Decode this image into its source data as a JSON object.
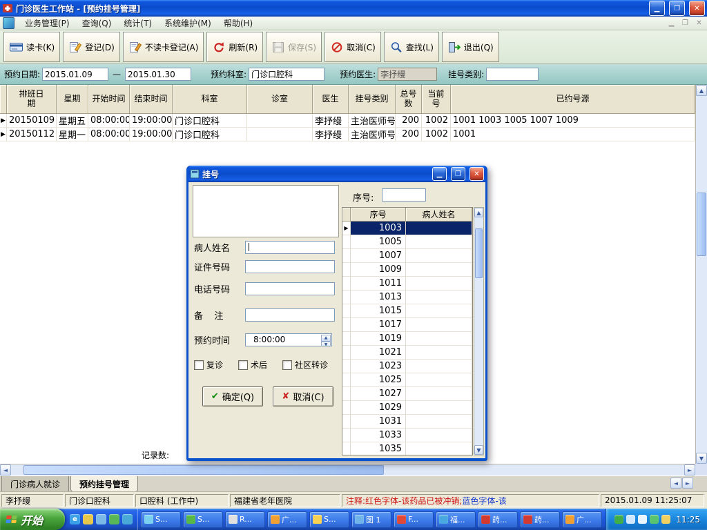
{
  "window": {
    "title": "门诊医生工作站 - [预约挂号管理]"
  },
  "menubar": {
    "items": [
      "业务管理(P)",
      "查询(Q)",
      "统计(T)",
      "系统维护(M)",
      "帮助(H)"
    ]
  },
  "toolbar": {
    "buttons": [
      {
        "label": "读卡(K)",
        "icon": "card",
        "disabled": false
      },
      {
        "label": "登记(D)",
        "icon": "register",
        "disabled": false
      },
      {
        "label": "不读卡登记(A)",
        "icon": "register2",
        "disabled": false
      },
      {
        "label": "刷新(R)",
        "icon": "refresh",
        "disabled": false
      },
      {
        "label": "保存(S)",
        "icon": "save",
        "disabled": true
      },
      {
        "label": "取消(C)",
        "icon": "cancel",
        "disabled": false
      },
      {
        "label": "查找(L)",
        "icon": "find",
        "disabled": false
      },
      {
        "label": "退出(Q)",
        "icon": "exit",
        "disabled": false
      }
    ]
  },
  "filters": {
    "date_label": "预约日期:",
    "date_from": "2015.01.09",
    "dash": "—",
    "date_to": "2015.01.30",
    "dept_label": "预约科室:",
    "dept_value": "门诊口腔科",
    "doctor_label": "预约医生:",
    "doctor_value": "李抒缦",
    "type_label": "挂号类别:",
    "type_value": ""
  },
  "grid": {
    "headers": [
      "排班日\n期",
      "星期",
      "开始时间",
      "结束时间",
      "科室",
      "诊室",
      "医生",
      "挂号类别",
      "总号\n数",
      "当前\n号",
      "已约号源"
    ],
    "rows": [
      {
        "pointer": true,
        "cells": [
          "20150109",
          "星期五",
          "08:00:00",
          "19:00:00",
          "门诊口腔科",
          "",
          "李抒缦",
          "主治医师号",
          "200",
          "1002",
          "1001 1003 1005 1007 1009"
        ]
      },
      {
        "pointer": true,
        "cells": [
          "20150112",
          "星期一",
          "08:00:00",
          "19:00:00",
          "门诊口腔科",
          "",
          "李抒缦",
          "主治医师号",
          "200",
          "1002",
          "1001"
        ]
      }
    ]
  },
  "records_label": "记录数:",
  "dialog": {
    "title": "挂号",
    "seq_label": "序号:",
    "seq_value": "",
    "fields": [
      {
        "label": "病人姓名",
        "value": ""
      },
      {
        "label": "证件号码",
        "value": ""
      },
      {
        "label": "电话号码",
        "value": ""
      },
      {
        "label": "备    注",
        "value": ""
      }
    ],
    "time_label": "预约时间",
    "time_value": "8:00:00",
    "checkboxes": [
      {
        "label": "复诊",
        "checked": false
      },
      {
        "label": "术后",
        "checked": false
      },
      {
        "label": "社区转诊",
        "checked": false
      }
    ],
    "ok_icon": "✔",
    "ok_label": "确定(Q)",
    "cancel_icon": "✘",
    "cancel_label": "取消(C)",
    "grid": {
      "headers": [
        "序号",
        "病人姓名"
      ],
      "rows": [
        {
          "seq": "1003",
          "name": "",
          "selected": true
        },
        {
          "seq": "1005",
          "name": "",
          "selected": false
        },
        {
          "seq": "1007",
          "name": "",
          "selected": false
        },
        {
          "seq": "1009",
          "name": "",
          "selected": false
        },
        {
          "seq": "1011",
          "name": "",
          "selected": false
        },
        {
          "seq": "1013",
          "name": "",
          "selected": false
        },
        {
          "seq": "1015",
          "name": "",
          "selected": false
        },
        {
          "seq": "1017",
          "name": "",
          "selected": false
        },
        {
          "seq": "1019",
          "name": "",
          "selected": false
        },
        {
          "seq": "1021",
          "name": "",
          "selected": false
        },
        {
          "seq": "1023",
          "name": "",
          "selected": false
        },
        {
          "seq": "1025",
          "name": "",
          "selected": false
        },
        {
          "seq": "1027",
          "name": "",
          "selected": false
        },
        {
          "seq": "1029",
          "name": "",
          "selected": false
        },
        {
          "seq": "1031",
          "name": "",
          "selected": false
        },
        {
          "seq": "1033",
          "name": "",
          "selected": false
        },
        {
          "seq": "1035",
          "name": "",
          "selected": false
        }
      ]
    }
  },
  "tabs": {
    "items": [
      {
        "label": "门诊病人就诊",
        "active": false
      },
      {
        "label": "预约挂号管理",
        "active": true
      }
    ]
  },
  "statusbar": {
    "panels": [
      "李抒缦",
      "门诊口腔科",
      "口腔科 (工作中)",
      "福建省老年医院"
    ],
    "note_red": "注释:红色字体-该药品已被冲销;",
    "note_blue": " 蓝色字体-该",
    "timestamp": "2015.01.09 11:25:07"
  },
  "taskbar": {
    "start_label": "开始",
    "quick_launch": [
      {
        "name": "ie-icon",
        "glyph": "e",
        "color": "#3aa0e8"
      },
      {
        "name": "mail-icon",
        "glyph": "",
        "color": "#e8c84a"
      },
      {
        "name": "desktop-icon",
        "glyph": "",
        "color": "#7ab8e8"
      },
      {
        "name": "media-icon",
        "glyph": "",
        "color": "#58b858"
      },
      {
        "name": "messenger-icon",
        "glyph": "",
        "color": "#48a8d8"
      }
    ],
    "tasks": [
      {
        "label": "S...",
        "color": "#7ad0f0"
      },
      {
        "label": "S...",
        "color": "#57b847"
      },
      {
        "label": "R...",
        "color": "#e0e0e0"
      },
      {
        "label": "广...",
        "color": "#f0a030"
      },
      {
        "label": "S...",
        "color": "#f7d154"
      },
      {
        "label": "图 1",
        "color": "#6fb3e8"
      },
      {
        "label": "F...",
        "color": "#e04838"
      },
      {
        "label": "福...",
        "color": "#4aa8e0"
      },
      {
        "label": "药...",
        "color": "#d03a30"
      },
      {
        "label": "药...",
        "color": "#d03a30"
      },
      {
        "label": "广...",
        "color": "#f0a030"
      }
    ],
    "tray_icons": [
      {
        "name": "antivirus-icon",
        "color": "#3fae49"
      },
      {
        "name": "network-icon",
        "color": "#cfe8ff"
      },
      {
        "name": "volume-icon",
        "color": "#e8f4ff"
      },
      {
        "name": "input-method-icon",
        "color": "#58c470"
      },
      {
        "name": "update-icon",
        "color": "#f0d060"
      }
    ],
    "tray_time": "11:25"
  },
  "colors": {
    "titlebar_blue": "#0b4ccc",
    "selection_navy": "#0a246a",
    "filterbar_teal": "#93c6c2",
    "panel_beige": "#ece9d8",
    "note_red": "#cc1111",
    "note_blue": "#1133cc",
    "start_green": "#4aa63c"
  }
}
